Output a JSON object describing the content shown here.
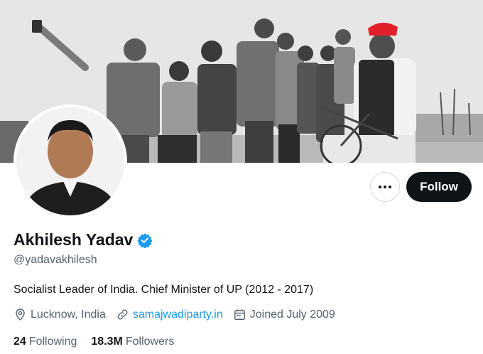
{
  "profile": {
    "name": "Akhilesh Yadav",
    "handle": "@yadavakhilesh",
    "bio": "Socialist Leader of India. Chief Minister of UP (2012 - 2017)",
    "location": "Lucknow, India",
    "website": "samajwadiparty.in",
    "joined": "Joined July 2009",
    "verified": true
  },
  "actions": {
    "follow_label": "Follow",
    "more_icon": "more-horizontal-icon"
  },
  "stats": {
    "following_count": "24",
    "following_label": "Following",
    "followers_count": "18.3M",
    "followers_label": "Followers"
  },
  "colors": {
    "text_primary": "#0f1419",
    "text_secondary": "#536471",
    "link": "#1d9bf0",
    "verified": "#1d9bf0",
    "follow_bg": "#0f1419",
    "cap_red": "#e0202a"
  }
}
